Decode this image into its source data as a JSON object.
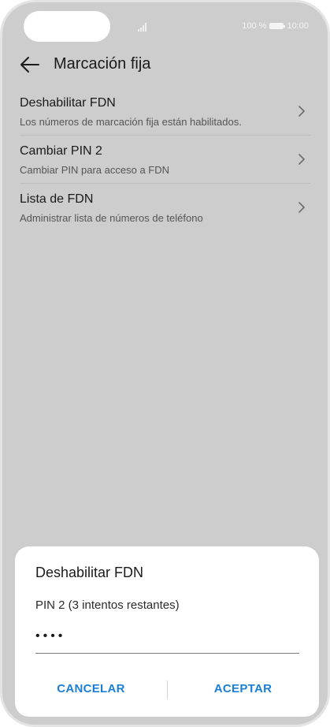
{
  "status_bar": {
    "battery": "100 %",
    "time": "10:00"
  },
  "header": {
    "title": "Marcación fija"
  },
  "list": {
    "items": [
      {
        "title": "Deshabilitar FDN",
        "subtitle": "Los números de marcación fija están habilitados."
      },
      {
        "title": "Cambiar PIN 2",
        "subtitle": "Cambiar PIN para acceso a FDN"
      },
      {
        "title": "Lista de FDN",
        "subtitle": "Administrar lista de números de teléfono"
      }
    ]
  },
  "dialog": {
    "title": "Deshabilitar FDN",
    "label": "PIN 2 (3 intentos restantes)",
    "input_value": "••••",
    "cancel_label": "CANCELAR",
    "accept_label": "ACEPTAR"
  },
  "colors": {
    "accent": "#1a7fd6",
    "dimmed_background": "#cdcdcd"
  },
  "icons": {
    "back": "arrow-left-icon",
    "chevron": "chevron-right-icon",
    "signal": "signal-icon",
    "battery": "battery-icon"
  }
}
